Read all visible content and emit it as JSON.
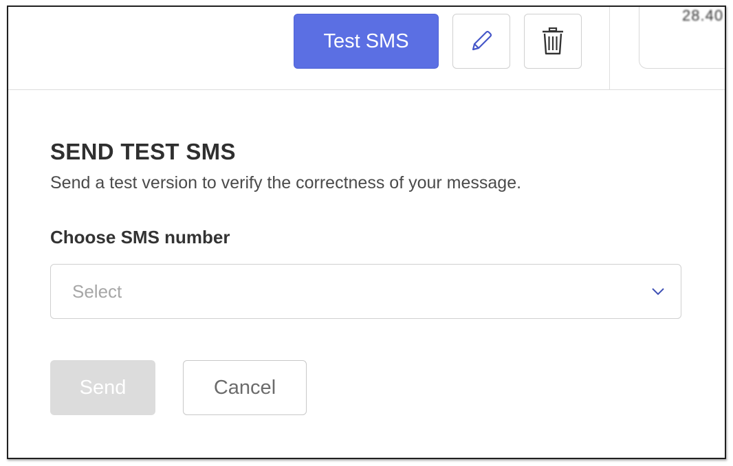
{
  "toolbar": {
    "test_sms_label": "Test SMS",
    "edit_icon": "pencil-icon",
    "delete_icon": "trash-icon",
    "corner_text": "28.40"
  },
  "dialog": {
    "title": "SEND TEST SMS",
    "subtitle": "Send a test version to verify the correctness of your message.",
    "field_label": "Choose SMS number",
    "select": {
      "placeholder": "Select",
      "icon": "chevron-down-icon"
    },
    "send_label": "Send",
    "cancel_label": "Cancel"
  },
  "colors": {
    "primary": "#5b6fe3",
    "disabled": "#dcdcdc",
    "border": "#cfcfcf",
    "chevron": "#3f51b5"
  }
}
